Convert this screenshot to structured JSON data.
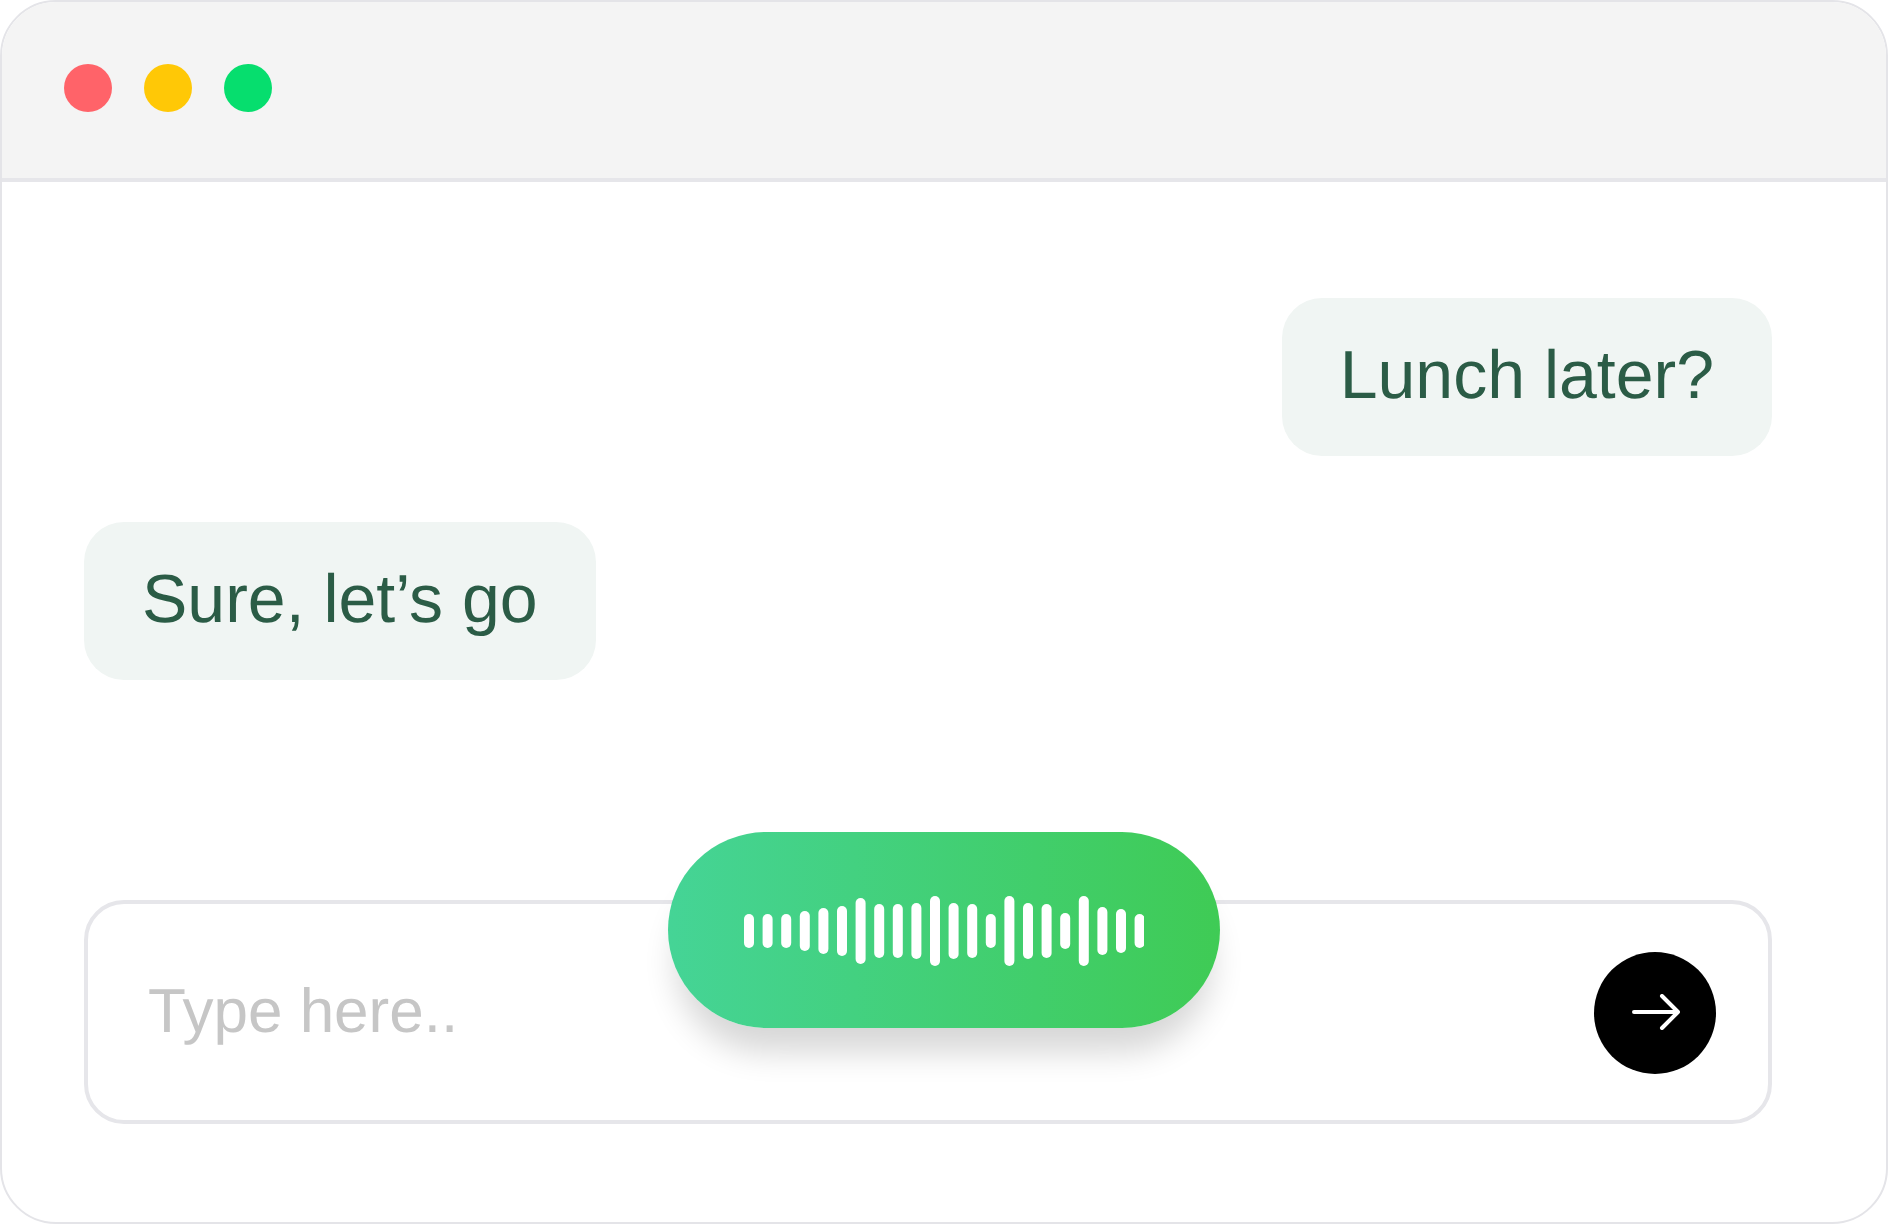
{
  "window": {
    "controls": [
      {
        "color": "#ff6369"
      },
      {
        "color": "#ffc806"
      },
      {
        "color": "#06de6e"
      }
    ]
  },
  "messages": [
    {
      "kind": "sent",
      "text": "Lunch later?"
    },
    {
      "kind": "received",
      "text": "Sure, let’s go"
    }
  ],
  "composer": {
    "placeholder": "Type here..",
    "recording": true
  }
}
